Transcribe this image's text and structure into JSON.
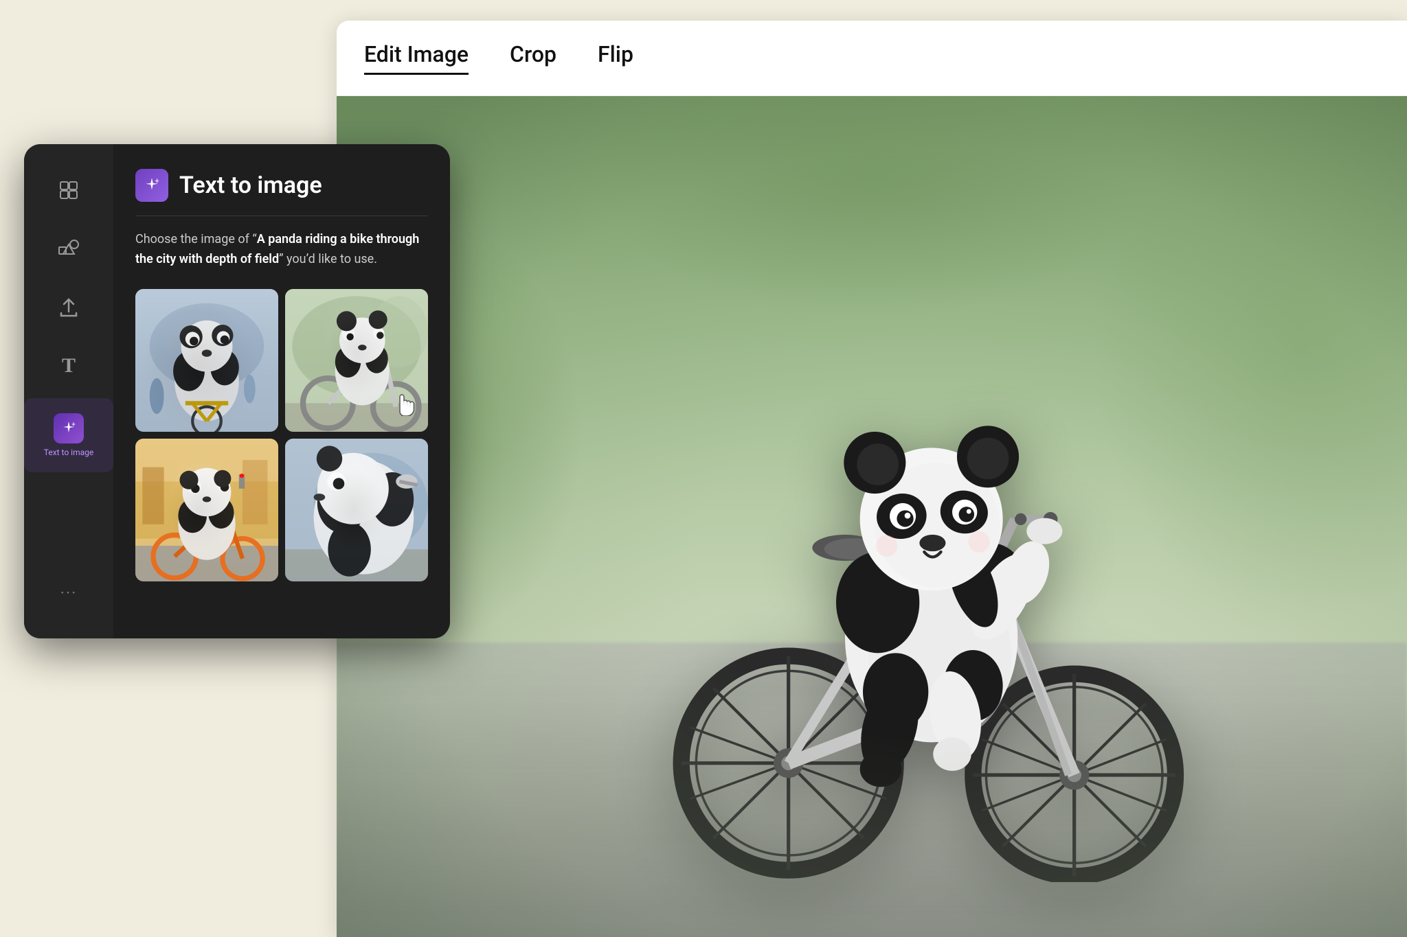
{
  "app": {
    "background_color": "#f0edde"
  },
  "edit_panel": {
    "tabs": [
      {
        "label": "Edit Image",
        "active": true
      },
      {
        "label": "Crop",
        "active": false
      },
      {
        "label": "Flip",
        "active": false
      }
    ]
  },
  "sidebar": {
    "icons": [
      {
        "name": "layout-icon",
        "symbol": "⊞",
        "label": "",
        "active": false
      },
      {
        "name": "shapes-icon",
        "symbol": "♡△□◯",
        "label": "",
        "active": false
      },
      {
        "name": "upload-icon",
        "symbol": "↑",
        "label": "",
        "active": false
      },
      {
        "name": "text-icon",
        "symbol": "T",
        "label": "",
        "active": false
      },
      {
        "name": "ai-generate-icon",
        "symbol": "✦",
        "label": "Text to image",
        "active": true
      }
    ],
    "more_label": "···"
  },
  "text_to_image_panel": {
    "title": "Text to image",
    "ai_icon": "✦",
    "description_prefix": "Choose the image of “",
    "description_bold": "A panda riding a bike through the city with depth of field",
    "description_suffix": "” you’d like to use.",
    "images": [
      {
        "id": 1,
        "alt": "Panda on bike - city street front view"
      },
      {
        "id": 2,
        "alt": "Panda on bike - side view blur",
        "hovered": true
      },
      {
        "id": 3,
        "alt": "Panda on bike - colorful street"
      },
      {
        "id": 4,
        "alt": "Panda on bike - close up"
      }
    ]
  },
  "main_image": {
    "alt": "AI generated panda riding a bicycle with depth of field effect"
  }
}
